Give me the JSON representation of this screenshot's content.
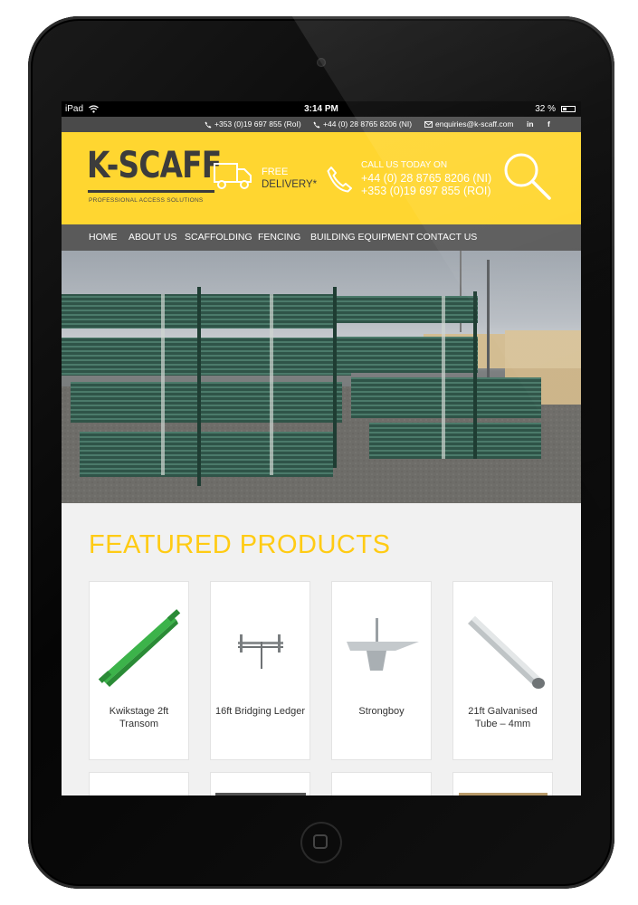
{
  "status_bar": {
    "device": "iPad",
    "time": "3:14 PM",
    "battery": "32 %"
  },
  "contact_bar": {
    "phone_roi": "+353 (0)19 697 855 (RoI)",
    "phone_ni": "+44 (0) 28 8765 8206 (NI)",
    "email": "enquiries@k-scaff.com",
    "linkedin": "in",
    "facebook": "f"
  },
  "header": {
    "logo": "K-SCAFF",
    "tagline": "PROFESSIONAL ACCESS SOLUTIONS",
    "delivery_line1": "FREE",
    "delivery_line2": "DELIVERY*",
    "call_label": "CALL US TODAY ON",
    "call_ni": "+44 (0) 28 8765 8206 (NI)",
    "call_roi": "+353 (0)19 697 855 (ROI)"
  },
  "nav": {
    "items": [
      "HOME",
      "ABOUT US",
      "SCAFFOLDING",
      "FENCING",
      "BUILDING EQUIPMENT",
      "CONTACT US"
    ]
  },
  "featured": {
    "title": "FEATURED PRODUCTS",
    "products": [
      {
        "name": "Kwikstage 2ft Transom"
      },
      {
        "name": "16ft Bridging Ledger"
      },
      {
        "name": "Strongboy"
      },
      {
        "name": "21ft Galvanised Tube – 4mm"
      }
    ]
  },
  "colors": {
    "brand_yellow": "#ffd630",
    "title_yellow": "#ffcb14",
    "nav_grey": "#5a5a5a",
    "dark_text": "#3c3c3c"
  },
  "icons": [
    "wifi-icon",
    "battery-icon",
    "phone-icon",
    "email-icon",
    "linkedin-icon",
    "facebook-icon",
    "truck-icon",
    "search-icon"
  ]
}
